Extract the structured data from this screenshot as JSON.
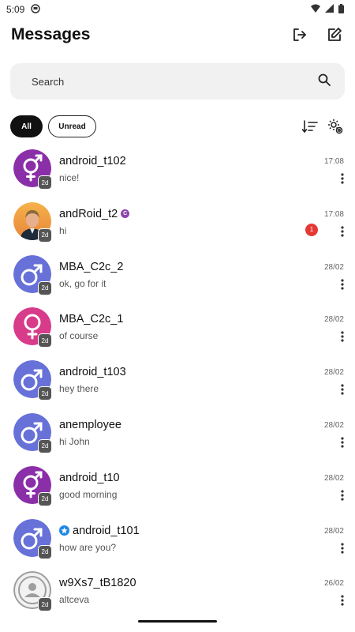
{
  "status_bar": {
    "time": "5:09"
  },
  "header": {
    "title": "Messages",
    "icons": [
      "logout-icon",
      "compose-icon"
    ]
  },
  "search": {
    "placeholder": "Search",
    "icon": "search-icon"
  },
  "filters": {
    "all_label": "All",
    "unread_label": "Unread",
    "icons": [
      "sort-icon",
      "settings-icon"
    ]
  },
  "colors": {
    "male": "#6771d8",
    "female": "#8b2fa8",
    "pink": "#d83b8a",
    "unread": "#e53935",
    "verified": "#1e88e5",
    "c_tag": "#8e44ad"
  },
  "conversations": [
    {
      "name": "android_t102",
      "preview": "nice!",
      "time": "17:08",
      "age": "2d",
      "avatar": "intersex"
    },
    {
      "name": "andRoid_t2",
      "preview": "hi",
      "time": "17:08",
      "age": "2d",
      "avatar": "photo",
      "tag": "C",
      "unread": "1"
    },
    {
      "name": "MBA_C2c_2",
      "preview": "ok, go for it",
      "time": "28/02",
      "age": "2d",
      "avatar": "male"
    },
    {
      "name": "MBA_C2c_1",
      "preview": "of course",
      "time": "28/02",
      "age": "2d",
      "avatar": "female"
    },
    {
      "name": "android_t103",
      "preview": "hey there",
      "time": "28/02",
      "age": "2d",
      "avatar": "male"
    },
    {
      "name": "anemployee",
      "preview": "hi John",
      "time": "28/02",
      "age": "2d",
      "avatar": "male"
    },
    {
      "name": "android_t10",
      "preview": "good morning",
      "time": "28/02",
      "age": "2d",
      "avatar": "intersex"
    },
    {
      "name": "android_t101",
      "preview": "how are you?",
      "time": "28/02",
      "age": "2d",
      "avatar": "male",
      "verified": true
    },
    {
      "name": "w9Xs7_tB1820",
      "preview": "altceva",
      "time": "26/02",
      "age": "2d",
      "avatar": "default"
    }
  ]
}
